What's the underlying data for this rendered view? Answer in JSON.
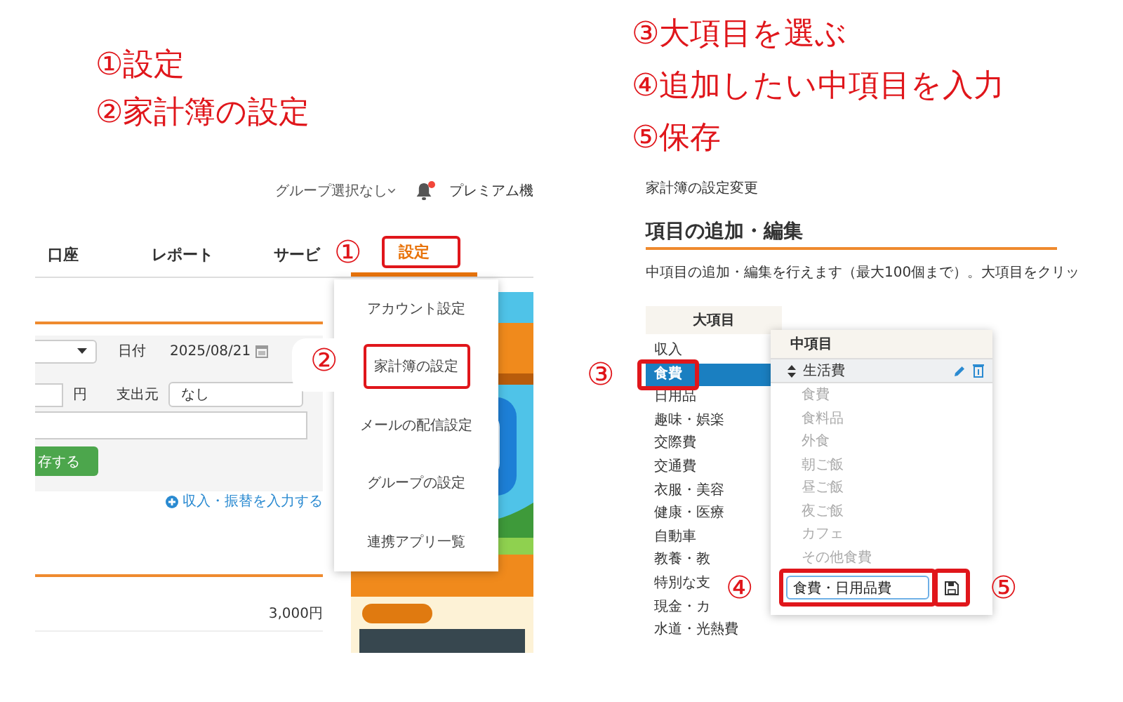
{
  "left_steps": [
    "①設定",
    "②家計簿の設定"
  ],
  "right_steps": [
    "③大項目を選ぶ",
    "④追加したい中項目を入力",
    "⑤保存"
  ],
  "left_screenshot": {
    "group_select": "グループ選択なし",
    "notification_dot": true,
    "premium": "プレミアム機",
    "nav_tabs": [
      {
        "label": "口座",
        "selected": false,
        "highlighted": false
      },
      {
        "label": "レポート",
        "selected": false,
        "highlighted": false
      },
      {
        "label": "サービ",
        "selected": false,
        "highlighted": false
      },
      {
        "label": "設定",
        "selected": true,
        "highlighted": true
      }
    ],
    "tab_marker": "①",
    "form": {
      "date_label": "日付",
      "date_value": "2025/08/21",
      "yen_label": "円",
      "source_label": "支出元",
      "source_value": "なし",
      "save_button": "存する"
    },
    "income_link": "収入・振替を入力する",
    "amounts": [
      "3,000円"
    ],
    "ad": {
      "kind": "picture"
    },
    "settings_menu": [
      {
        "label": "アカウント設定",
        "highlighted": false
      },
      {
        "label": "家計簿の設定",
        "highlighted": true
      },
      {
        "label": "メールの配信設定",
        "highlighted": false
      },
      {
        "label": "グループの設定",
        "highlighted": false
      },
      {
        "label": "連携アプリ一覧",
        "highlighted": false
      }
    ],
    "menu_marker": "②"
  },
  "right_screenshot": {
    "breadcrumb": "家計簿の設定変更",
    "heading": "項目の追加・編集",
    "description": "中項目の追加・編集を行えます（最大100個まで）。大項目をクリッ",
    "major_header": "大項目",
    "major_items": [
      {
        "label": "収入",
        "selected": false,
        "highlighted": false
      },
      {
        "label": "食費",
        "selected": true,
        "highlighted": true
      },
      {
        "label": "日用品",
        "selected": false,
        "highlighted": false
      },
      {
        "label": "趣味・娯楽",
        "selected": false,
        "highlighted": false
      },
      {
        "label": "交際費",
        "selected": false,
        "highlighted": false
      },
      {
        "label": "交通費",
        "selected": false,
        "highlighted": false
      },
      {
        "label": "衣服・美容",
        "selected": false,
        "highlighted": false
      },
      {
        "label": "健康・医療",
        "selected": false,
        "highlighted": false
      },
      {
        "label": "自動車",
        "selected": false,
        "highlighted": false
      },
      {
        "label": "教養・教",
        "selected": false,
        "highlighted": false
      },
      {
        "label": "特別な支",
        "selected": false,
        "highlighted": false
      },
      {
        "label": "現金・カ",
        "selected": false,
        "highlighted": false
      },
      {
        "label": "水道・光熱費",
        "selected": false,
        "highlighted": false
      }
    ],
    "major_marker": "③",
    "popup": {
      "header": "中項目",
      "group": "生活費",
      "items": [
        "食費",
        "食料品",
        "外食",
        "朝ご飯",
        "昼ご飯",
        "夜ご飯",
        "カフェ",
        "その他食費"
      ],
      "input_value": "食費・日用品費",
      "input_highlighted": true,
      "save_highlighted": true,
      "input_marker": "④",
      "save_marker": "⑤"
    }
  }
}
